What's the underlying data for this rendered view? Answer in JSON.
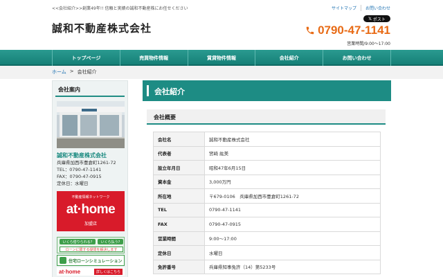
{
  "header": {
    "tagline": "<<会社紹介>>創業49年!! 信頼と実績の誠和不動産株にお任せください",
    "top_links": [
      "サイトマップ",
      "お問い合わせ"
    ],
    "post_button": "ポスト",
    "logo": "誠和不動産株式会社",
    "phone": "0790-47-1141",
    "hours": "営業時間/9:00〜17:00"
  },
  "nav": {
    "items": [
      "トップページ",
      "売買物件情報",
      "賃貸物件情報",
      "会社紹介",
      "お問い合わせ"
    ]
  },
  "breadcrumb": {
    "home": "ホーム",
    "separator": ">",
    "current": "会社紹介"
  },
  "sidebar": {
    "title": "会社案内",
    "company_name": "誠和不動産株式会社",
    "address": "兵庫県加西市豊倉町1261-72",
    "tel": "TEL：0790-47-1141",
    "fax": "FAX：0790-47-0915",
    "holiday": "定休日：水曜日",
    "athome_banner": {
      "top": "不動産情報ネットワーク",
      "logo": "at·home",
      "bottom": "加盟店"
    },
    "loan_banner": {
      "tag1": "いくら借りられる?",
      "tag2": "いくら払う?",
      "sub": "ローンに関する疑問を解決します"
    },
    "sim_banner": "住宅ローンシミュレーション",
    "athome_small": {
      "logo": "at·home",
      "link": "詳しくはこちら"
    }
  },
  "main": {
    "title": "会社紹介",
    "section_title": "会社概要",
    "rows": [
      {
        "label": "会社名",
        "value": "誠和不動産株式会社"
      },
      {
        "label": "代表者",
        "value": "宮崎 紘美"
      },
      {
        "label": "設立年月日",
        "value": "昭和47年6月15日"
      },
      {
        "label": "資本金",
        "value": "3,000万円"
      },
      {
        "label": "所在地",
        "value": "〒679-0106　兵庫県加西市豊倉町1261-72"
      },
      {
        "label": "TEL",
        "value": "0790-47-1141"
      },
      {
        "label": "FAX",
        "value": "0790-47-0915"
      },
      {
        "label": "営業時間",
        "value": "9:00〜17:00"
      },
      {
        "label": "定休日",
        "value": "水曜日"
      },
      {
        "label": "免許番号",
        "value": "兵庫県知事免許（14）第5233号"
      }
    ]
  },
  "colors": {
    "accent": "#1d8c84",
    "phone": "#e86b16",
    "athome_red": "#d81b2a"
  }
}
